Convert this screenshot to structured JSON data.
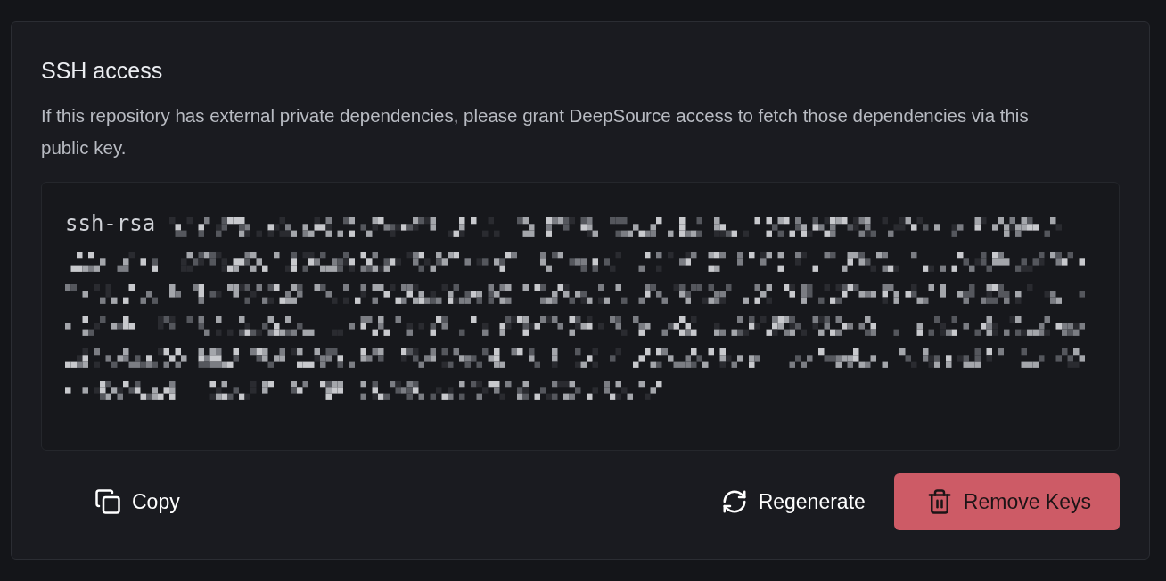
{
  "section": {
    "title": "SSH access",
    "description": "If this repository has external private dependencies, please grant DeepSource access to fetch those dependencies via this public key."
  },
  "key": {
    "prefix": "ssh-rsa"
  },
  "actions": [
    {
      "kind": "copy",
      "label": "Copy"
    },
    {
      "kind": "regenerate",
      "label": "Regenerate"
    },
    {
      "kind": "remove",
      "label": "Remove Keys"
    }
  ]
}
